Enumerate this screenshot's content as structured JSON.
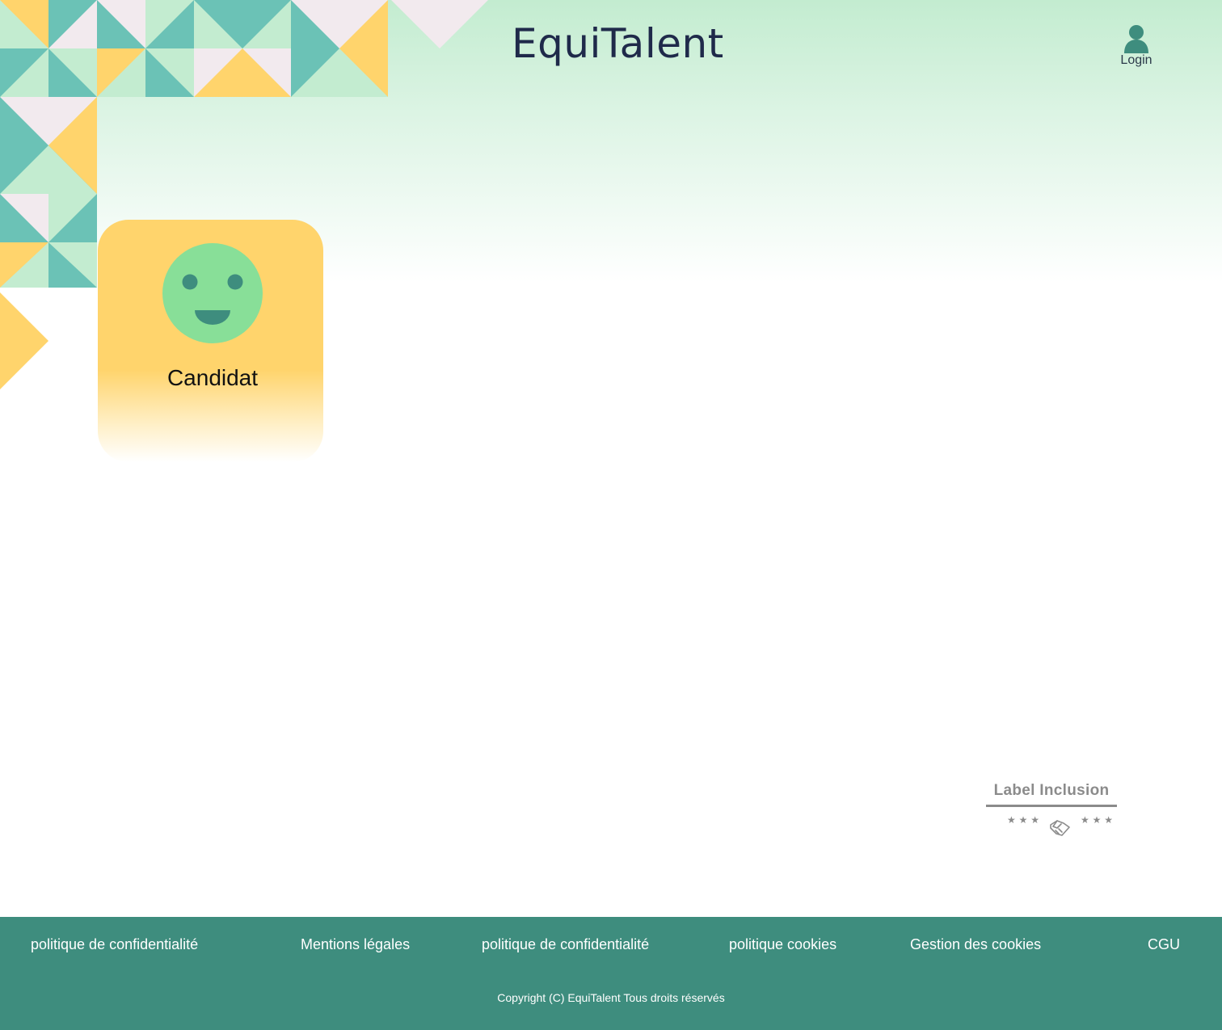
{
  "header": {
    "logo_text": "EquiTalent",
    "login_label": "Login"
  },
  "card": {
    "label": "Candidat"
  },
  "badge": {
    "title": "Label Inclusion",
    "stars_left": "★ ★ ★",
    "stars_right": "★ ★ ★"
  },
  "footer": {
    "links": [
      "politique de confidentialité",
      "Mentions légales",
      "politique de confidentialité",
      "politique cookies",
      "Gestion des cookies",
      "CGU"
    ],
    "copyright": "Copyright (C) EquiTalent Tous droits réservés"
  },
  "icons": {
    "user": "user-icon",
    "smiley": "smiley-icon",
    "handshake": "handshake-icon"
  },
  "colors": {
    "teal": "#6bc2b6",
    "mint": "#c3ecd0",
    "yellow": "#ffd46c",
    "pink": "#f2eaee",
    "footer": "#3e8d7e",
    "logo": "#1f2a4a"
  }
}
